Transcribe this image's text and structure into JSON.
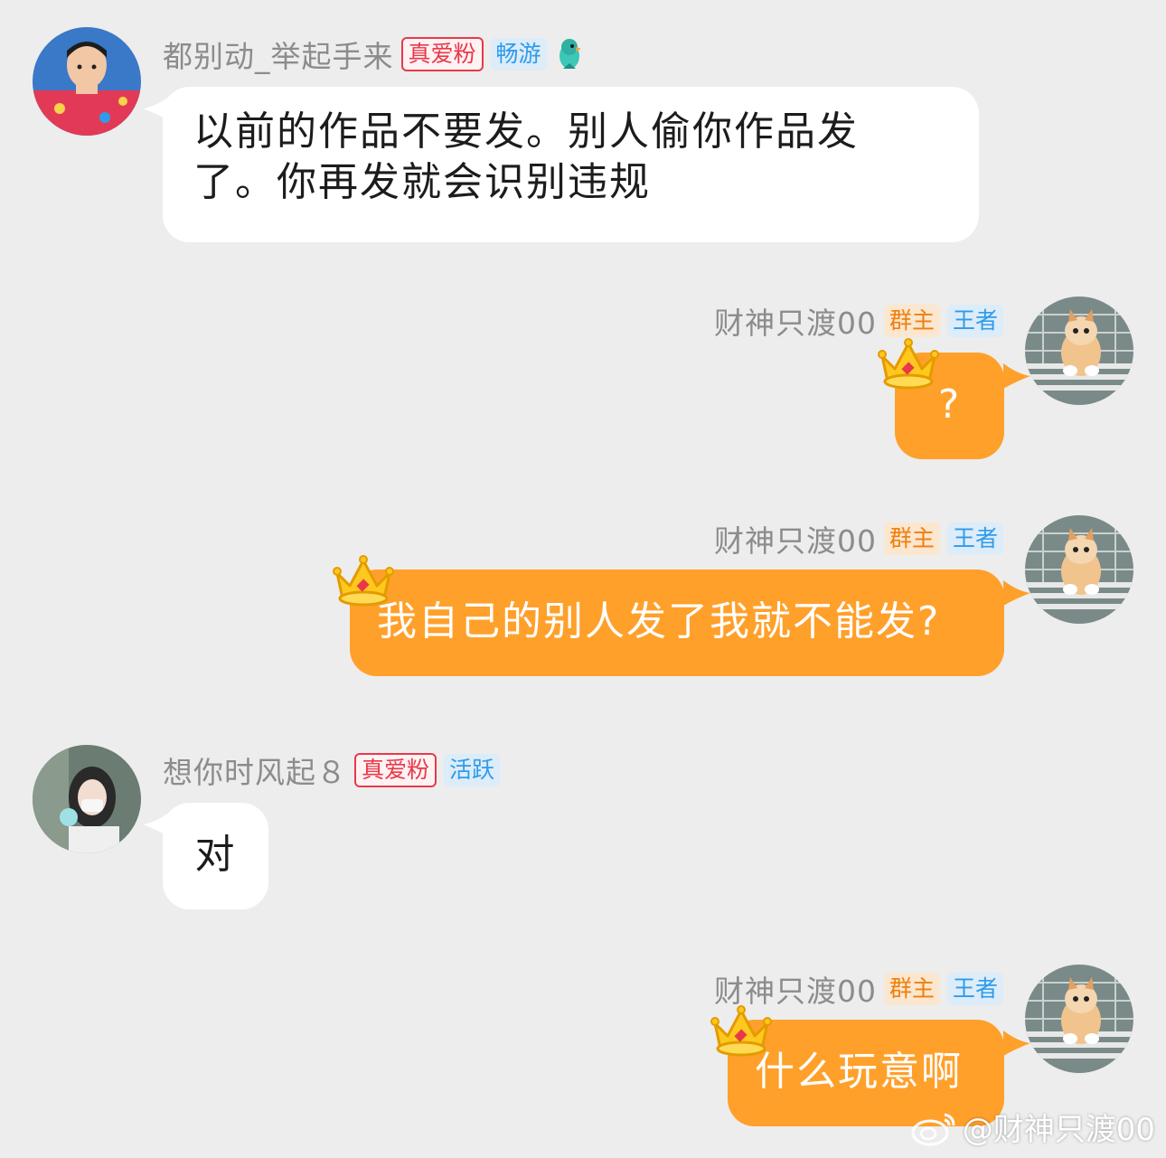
{
  "messages": [
    {
      "sender": "都别动_举起手来",
      "fan_badge": "真爱粉",
      "level_badge": "畅游",
      "lines": [
        "以前的作品不要发。别人偷你作品发",
        "了。你再发就会识别违规"
      ]
    },
    {
      "sender": "财神只渡00",
      "owner_badge": "群主",
      "level_badge": "王者",
      "text": "?"
    },
    {
      "sender": "财神只渡00",
      "owner_badge": "群主",
      "level_badge": "王者",
      "text": "我自己的别人发了我就不能发?"
    },
    {
      "sender": "想你时风起８",
      "fan_badge": "真爱粉",
      "level_badge": "活跃",
      "text": "对"
    },
    {
      "sender": "财神只渡00",
      "owner_badge": "群主",
      "level_badge": "王者",
      "text": "什么玩意啊"
    }
  ],
  "watermark": "@财神只渡00",
  "colors": {
    "background": "#ededed",
    "own_bubble": "#ffa02b",
    "other_bubble": "#ffffff",
    "name": "#8c8c8c"
  },
  "icons": {
    "bird_badge": "parrot-icon",
    "crown": "crown-icon",
    "watermark": "weibo-icon"
  }
}
